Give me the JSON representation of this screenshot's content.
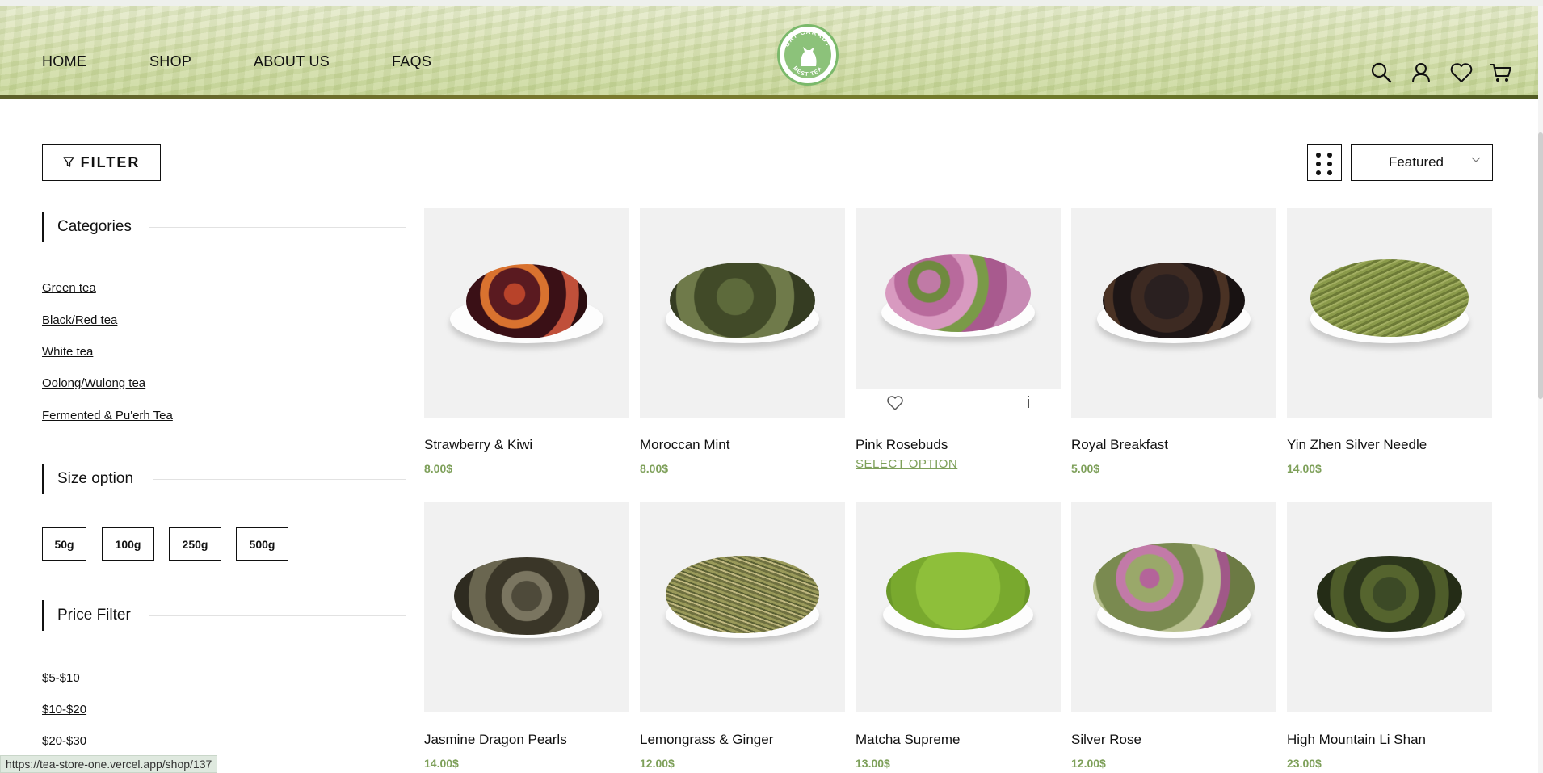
{
  "header": {
    "nav": [
      "HOME",
      "SHOP",
      "ABOUT US",
      "FAQS"
    ],
    "logo_text": {
      "top": "CAT CARROT",
      "bottom": "BEST TEA"
    },
    "icons": [
      "search-icon",
      "user-icon",
      "heart-icon",
      "cart-icon"
    ]
  },
  "toolbar": {
    "filter_label": "FILTER",
    "sort_value": "Featured"
  },
  "sidebar": {
    "categories_title": "Categories",
    "categories": [
      "Green tea",
      "Black/Red tea",
      "White tea",
      "Oolong/Wulong tea",
      "Fermented & Pu'erh Tea"
    ],
    "size_title": "Size option",
    "sizes": [
      "50g",
      "100g",
      "250g",
      "500g"
    ],
    "price_title": "Price Filter",
    "prices": [
      "$5-$10",
      "$10-$20",
      "$20-$30"
    ]
  },
  "products": [
    {
      "name": "Strawberry & Kiwi",
      "price": "8.00$"
    },
    {
      "name": "Moroccan Mint",
      "price": "8.00$"
    },
    {
      "name": "Pink Rosebuds",
      "price": "",
      "action": "SELECT OPTION"
    },
    {
      "name": "Royal Breakfast",
      "price": "5.00$"
    },
    {
      "name": "Yin Zhen Silver Needle",
      "price": "14.00$"
    },
    {
      "name": "Jasmine Dragon Pearls",
      "price": "14.00$"
    },
    {
      "name": "Lemongrass & Ginger",
      "price": "12.00$"
    },
    {
      "name": "Matcha Supreme",
      "price": "13.00$"
    },
    {
      "name": "Silver Rose",
      "price": "12.00$"
    },
    {
      "name": "High Mountain Li Shan",
      "price": "23.00$"
    }
  ],
  "hover_card": {
    "info_label": "i"
  },
  "status_bar": {
    "url": "https://tea-store-one.vercel.app/shop/137"
  },
  "colors": {
    "accent_green": "#7ea05a",
    "logo_green": "#8cc27a"
  }
}
